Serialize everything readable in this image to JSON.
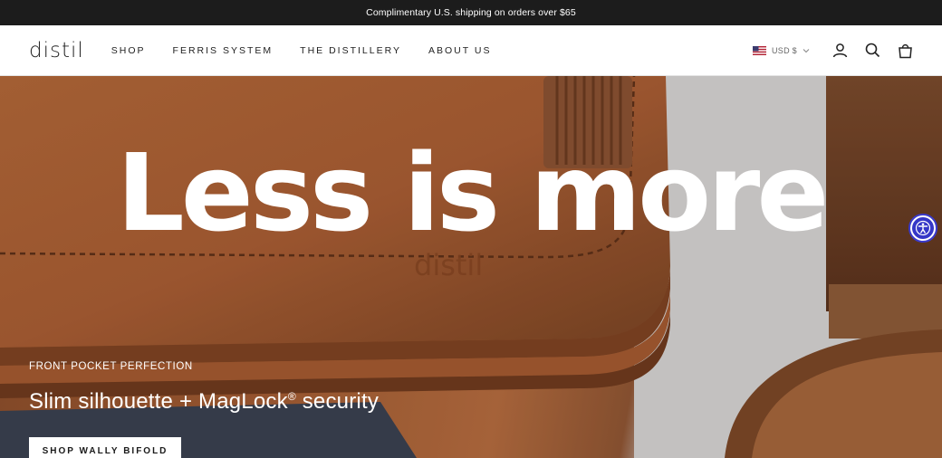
{
  "announcement": {
    "text": "Complimentary U.S. shipping on orders over $65"
  },
  "header": {
    "logo": "distil",
    "nav": [
      {
        "label": "SHOP"
      },
      {
        "label": "FERRIS SYSTEM"
      },
      {
        "label": "THE DISTILLERY"
      },
      {
        "label": "ABOUT US"
      }
    ],
    "currency": {
      "label": "USD $",
      "flag": "us-flag-icon"
    },
    "icons": [
      "account-icon",
      "search-icon",
      "cart-icon"
    ]
  },
  "hero": {
    "headline": "Less is more",
    "emboss": "distil",
    "kicker": "FRONT POCKET PERFECTION",
    "subhead_main": "Slim silhouette + MagLock",
    "subhead_mark": "®",
    "subhead_tail": " security",
    "cta": "SHOP WALLY BIFOLD"
  },
  "accessibility": {
    "icon": "accessibility-icon",
    "accent": "#3537c7"
  }
}
